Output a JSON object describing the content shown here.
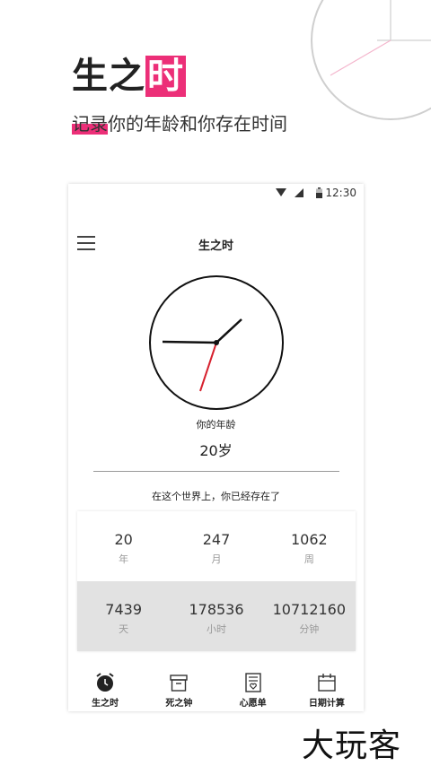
{
  "header": {
    "title_plain": "生之",
    "title_highlight": "时",
    "subtitle_highlight": "记录",
    "subtitle_rest": "你的年龄和你存在时间",
    "accent_color": "#ec2f78"
  },
  "status_bar": {
    "time": "12:30"
  },
  "app_bar": {
    "title": "生之时",
    "menu_icon": "hamburger-menu-icon"
  },
  "age": {
    "label": "你的年龄",
    "value": "20岁"
  },
  "existence_text": "在这个世界上，你已经存在了",
  "stats": [
    [
      {
        "value": "20",
        "unit": "年"
      },
      {
        "value": "247",
        "unit": "月"
      },
      {
        "value": "1062",
        "unit": "周"
      }
    ],
    [
      {
        "value": "7439",
        "unit": "天"
      },
      {
        "value": "178536",
        "unit": "小时"
      },
      {
        "value": "10712160",
        "unit": "分钟"
      }
    ]
  ],
  "tabs": [
    {
      "label": "生之时",
      "icon": "alarm-clock-icon"
    },
    {
      "label": "死之钟",
      "icon": "box-icon"
    },
    {
      "label": "心愿单",
      "icon": "wish-list-icon"
    },
    {
      "label": "日期计算",
      "icon": "calendar-icon"
    }
  ],
  "watermark": "大玩客"
}
